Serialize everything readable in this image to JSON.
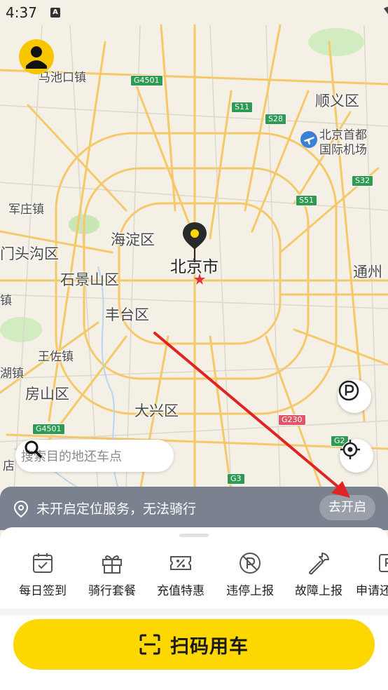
{
  "status_bar": {
    "time": "4:37",
    "notification_letter": "A"
  },
  "map": {
    "city_label": "北京市",
    "districts": [
      {
        "name": "马池口镇"
      },
      {
        "name": "顺义区"
      },
      {
        "name": "北京首都"
      },
      {
        "name": "国际机场"
      },
      {
        "name": "军庄镇"
      },
      {
        "name": "海淀区"
      },
      {
        "name": "门头沟区"
      },
      {
        "name": "石景山区"
      },
      {
        "name": "通州"
      },
      {
        "name": "镇"
      },
      {
        "name": "丰台区"
      },
      {
        "name": "王佐镇"
      },
      {
        "name": "湖镇"
      },
      {
        "name": "房山区"
      },
      {
        "name": "大兴区"
      },
      {
        "name": "店"
      }
    ],
    "road_signs": [
      {
        "code": "G4501",
        "color": "green"
      },
      {
        "code": "S11",
        "color": "green"
      },
      {
        "code": "S28",
        "color": "green"
      },
      {
        "code": "S32",
        "color": "green"
      },
      {
        "code": "S51",
        "color": "green"
      },
      {
        "code": "G230",
        "color": "red"
      },
      {
        "code": "G2",
        "color": "green"
      },
      {
        "code": "G3",
        "color": "green"
      },
      {
        "code": "G4501",
        "color": "green"
      }
    ],
    "parking_icon": "parking-icon",
    "locate_icon": "locate-icon"
  },
  "search": {
    "placeholder": "搜索目的地还车点"
  },
  "location_banner": {
    "message": "未开启定位服务，无法骑行",
    "action_label": "去开启"
  },
  "quick_actions": [
    {
      "label": "每日签到",
      "icon": "calendar-check-icon"
    },
    {
      "label": "骑行套餐",
      "icon": "gift-icon"
    },
    {
      "label": "充值特惠",
      "icon": "discount-ticket-icon"
    },
    {
      "label": "违停上报",
      "icon": "no-parking-icon"
    },
    {
      "label": "故障上报",
      "icon": "wrench-icon"
    },
    {
      "label": "申请还",
      "icon": "apply-return-icon"
    }
  ],
  "scan_button": {
    "label": "扫码用车",
    "icon": "scan-icon"
  },
  "colors": {
    "accent": "#fcd800",
    "banner": "#7a8290",
    "arrow": "#e02424"
  }
}
